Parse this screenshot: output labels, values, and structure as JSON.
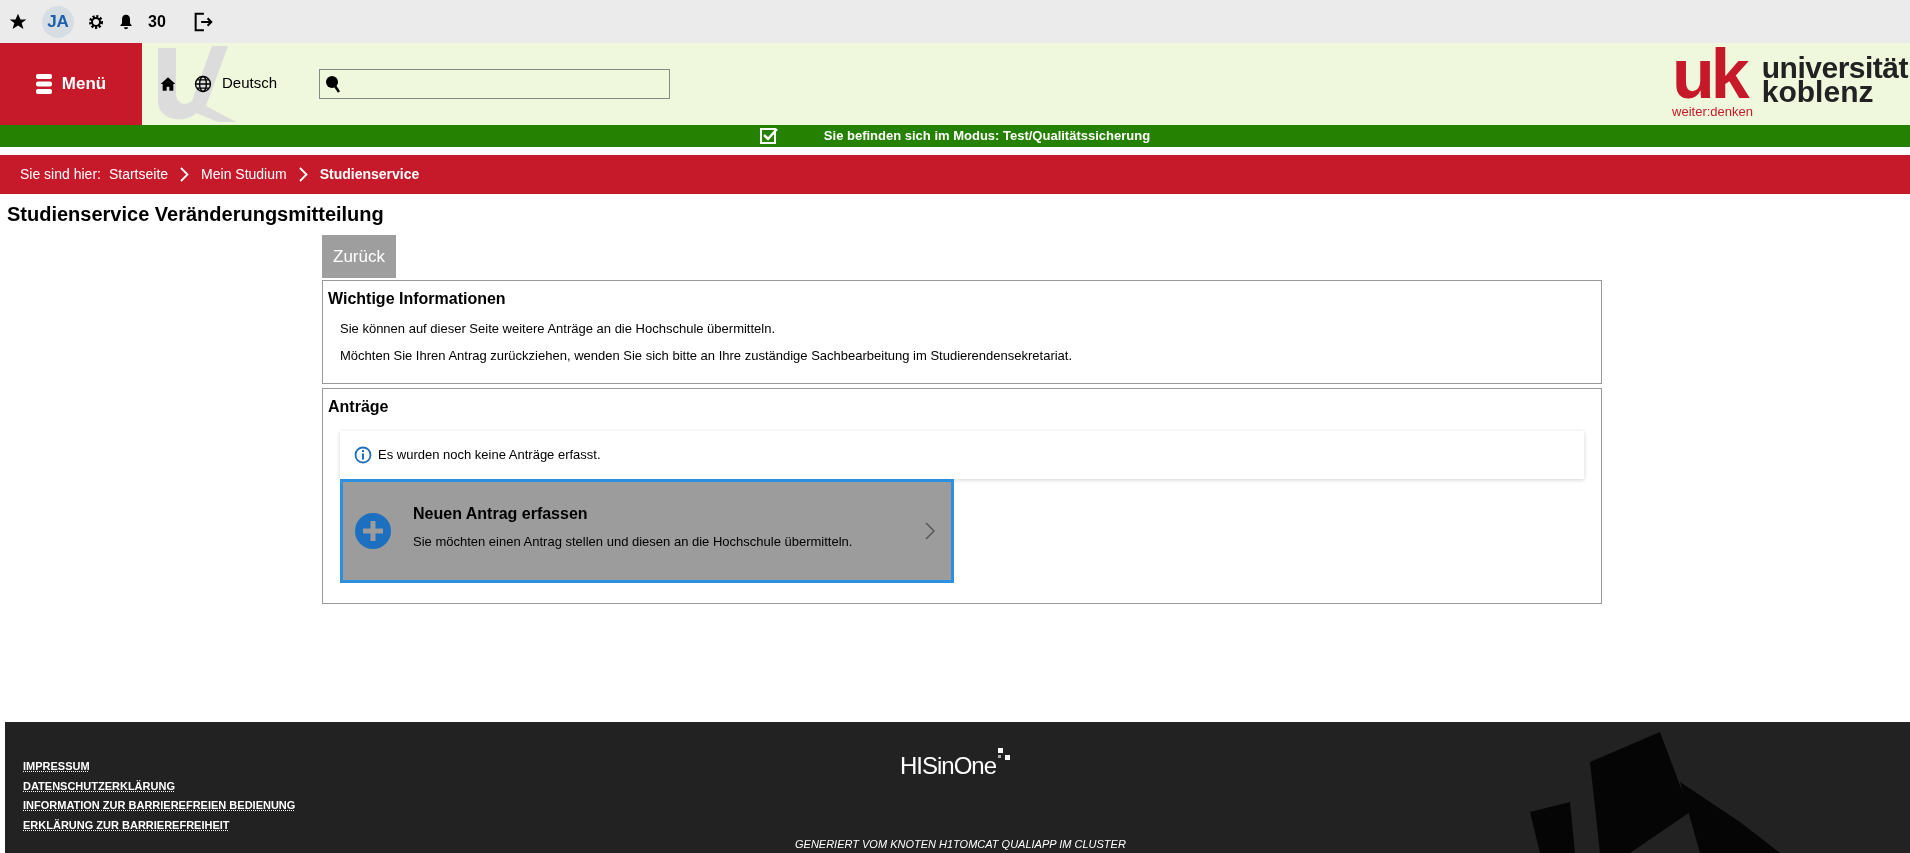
{
  "topbar": {
    "avatar": "JA",
    "notifications": "30"
  },
  "header": {
    "menu": "Menü",
    "language": "Deutsch",
    "logo": {
      "mark": "uk",
      "name_line1": "universität",
      "name_line2": "koblenz",
      "slogan": "weiter:denken"
    }
  },
  "mode_banner": {
    "checked": true,
    "text": "Sie befinden sich im Modus: Test/Qualitätssicherung"
  },
  "breadcrumb": {
    "label": "Sie sind hier:",
    "items": [
      {
        "label": "Startseite",
        "selected": false
      },
      {
        "label": "Mein Studium",
        "selected": false
      },
      {
        "label": "Studienservice",
        "selected": true
      }
    ]
  },
  "page_title": "Studienservice Veränderungsmitteilung",
  "back_button": "Zurück",
  "info_panel": {
    "title": "Wichtige Informationen",
    "lines": [
      "Sie können auf dieser Seite weitere Anträge an die Hochschule übermitteln.",
      "Möchten Sie Ihren Antrag zurückziehen, wenden Sie sich bitte an Ihre zuständige Sachbearbeitung im Studierendensekretariat."
    ]
  },
  "requests_panel": {
    "title": "Anträge",
    "notice": "Es wurden noch keine Anträge erfasst.",
    "new_request": {
      "title": "Neuen Antrag erfassen",
      "description": "Sie möchten einen Antrag stellen und diesen an die Hochschule übermitteln.",
      "selected": true
    }
  },
  "footer": {
    "links": [
      "IMPRESSUM",
      "DATENSCHUTZERKLÄRUNG",
      "INFORMATION ZUR BARRIEREFREIEN BEDIENUNG",
      "ERKLÄRUNG ZUR BARRIEREFREIHEIT"
    ],
    "brand": "HISinOne",
    "generated": "GENERIERT VOM KNOTEN H1TOMCAT QUALIAPP IM CLUSTER"
  }
}
